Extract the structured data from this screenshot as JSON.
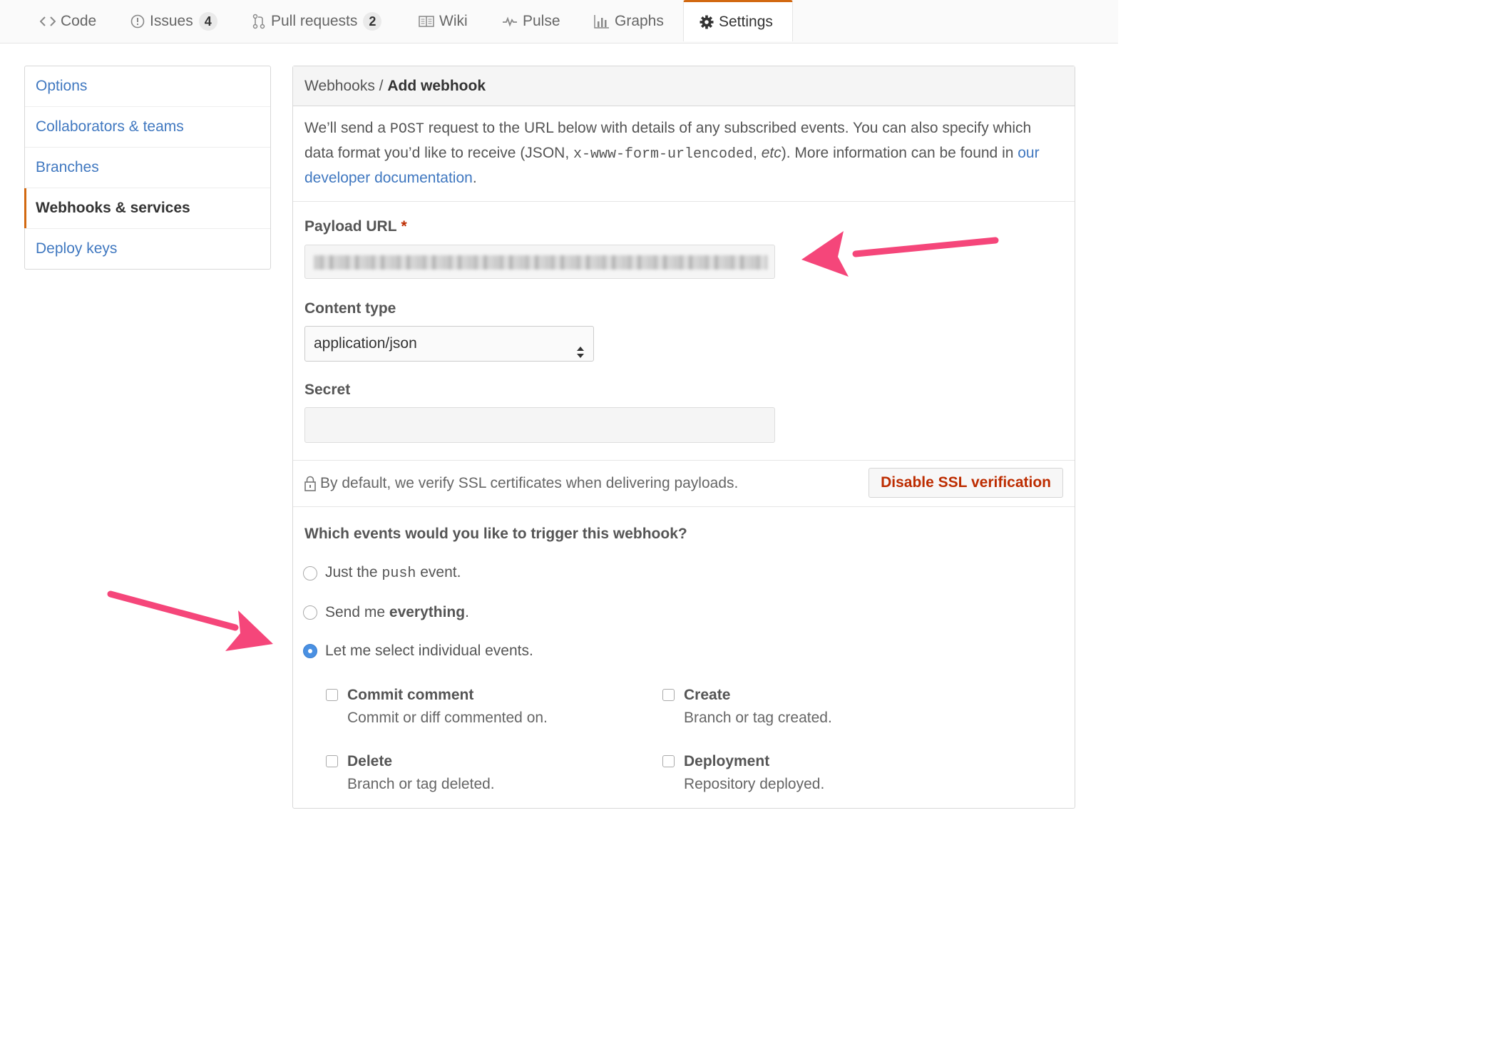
{
  "tabs": [
    {
      "label": "Code",
      "icon": "code-icon"
    },
    {
      "label": "Issues",
      "icon": "issue-icon",
      "count": "4"
    },
    {
      "label": "Pull requests",
      "icon": "pull-request-icon",
      "count": "2"
    },
    {
      "label": "Wiki",
      "icon": "book-icon"
    },
    {
      "label": "Pulse",
      "icon": "pulse-icon"
    },
    {
      "label": "Graphs",
      "icon": "graph-icon"
    },
    {
      "label": "Settings",
      "icon": "gear-icon",
      "selected": true
    }
  ],
  "sidebar": {
    "items": [
      {
        "label": "Options"
      },
      {
        "label": "Collaborators & teams"
      },
      {
        "label": "Branches"
      },
      {
        "label": "Webhooks & services",
        "active": true
      },
      {
        "label": "Deploy keys"
      }
    ]
  },
  "header": {
    "parent": "Webhooks",
    "separator": " / ",
    "current": "Add webhook"
  },
  "intro": {
    "part1": "We’ll send a ",
    "post": "POST",
    "part2": " request to the URL below with details of any subscribed events. You can also specify which data format you’d like to receive (JSON, ",
    "form": "x-www-form-urlencoded",
    "part3": ", ",
    "etc": "etc",
    "part4": "). More information can be found in ",
    "link": "our developer documentation",
    "part5": "."
  },
  "form": {
    "payload_label": "Payload URL",
    "required_mark": "*",
    "content_type_label": "Content type",
    "content_type_value": "application/json",
    "secret_label": "Secret",
    "secret_value": ""
  },
  "ssl": {
    "text": "By default, we verify SSL certificates when delivering payloads.",
    "button": "Disable SSL verification"
  },
  "events": {
    "question": "Which events would you like to trigger this webhook?",
    "options": [
      {
        "pre": "Just the ",
        "code": "push",
        "post": " event.",
        "checked": false
      },
      {
        "pre": "Send me ",
        "bold": "everything",
        "post": ".",
        "checked": false
      },
      {
        "pre": "Let me select individual events.",
        "checked": true
      }
    ],
    "list": [
      {
        "title": "Commit comment",
        "desc": "Commit or diff commented on."
      },
      {
        "title": "Create",
        "desc": "Branch or tag created."
      },
      {
        "title": "Delete",
        "desc": "Branch or tag deleted."
      },
      {
        "title": "Deployment",
        "desc": "Repository deployed."
      }
    ]
  },
  "colors": {
    "accent": "#d26911",
    "link": "#4078c0",
    "danger": "#bd2c00",
    "radio": "#4a90e2",
    "annotation_arrow": "#f5467a"
  }
}
